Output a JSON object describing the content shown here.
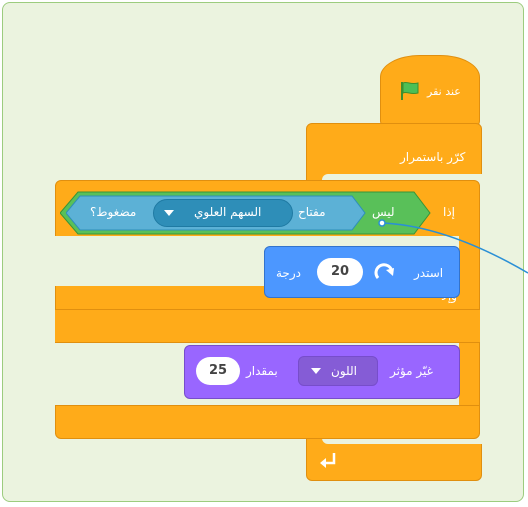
{
  "hat_block": {
    "label": "عند نقر"
  },
  "forever_block": {
    "label": "كرّر باستمرار"
  },
  "if_block": {
    "if_label": "إذا",
    "else_label": "وإلا"
  },
  "condition": {
    "not_label": "ليس",
    "key_label": "مفتاح",
    "key_value": "السهم العلوي",
    "pressed_label": "مضغوط؟"
  },
  "turn_block": {
    "label": "استدر",
    "value": "20",
    "unit": "درجة"
  },
  "effect_block": {
    "label": "غيّر مؤثر",
    "effect_value": "اللون",
    "by_label": "بمقدار",
    "amount": "25"
  },
  "icons": {
    "flag": "green-flag-icon",
    "turn": "turn-right-icon",
    "loop": "loop-arrow-icon",
    "dropdown": "dropdown-arrow-icon"
  },
  "colors": {
    "control": "#ffab19",
    "sensing": "#5cb1d6",
    "operators": "#59c059",
    "motion": "#4c97ff",
    "looks": "#9966ff"
  }
}
